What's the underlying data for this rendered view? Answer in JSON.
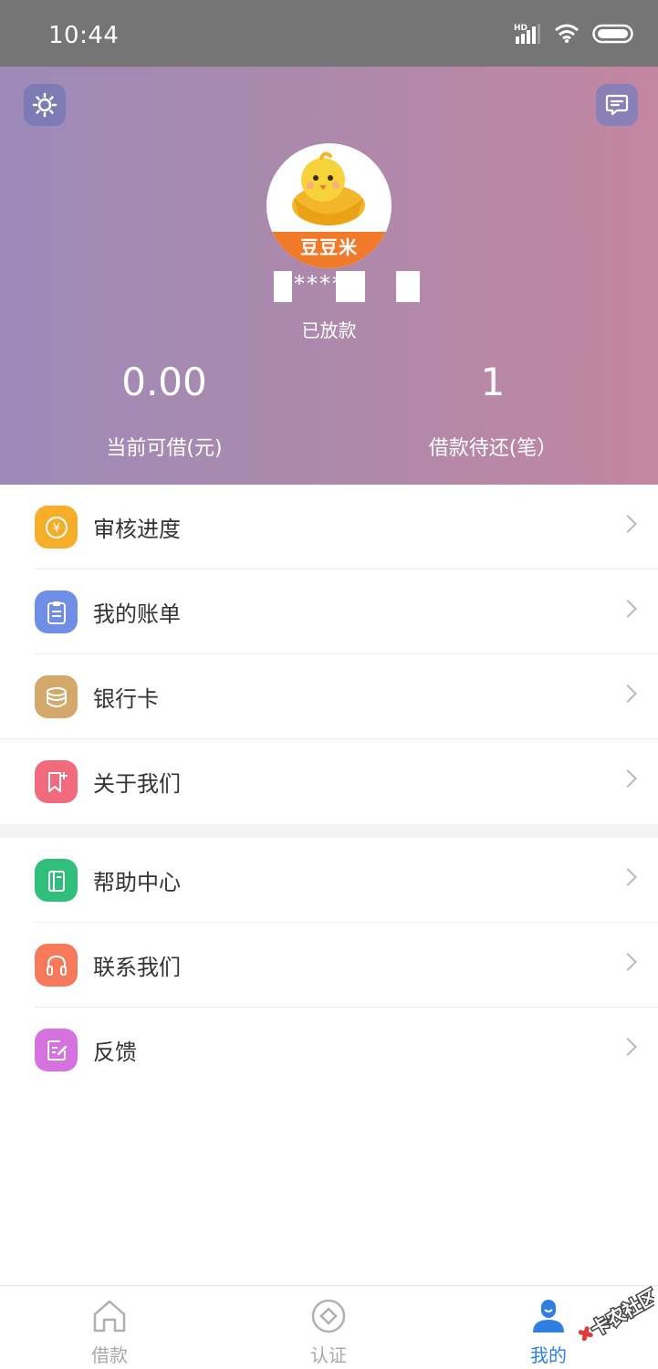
{
  "status_bar": {
    "time": "10:44",
    "network_badge": "HD"
  },
  "header": {
    "settings_icon": "gear-icon",
    "message_icon": "chat-bubble-icon",
    "avatar_text": "豆豆米",
    "username_visible": "****",
    "loan_status": "已放款",
    "stats": [
      {
        "value": "0.00",
        "label": "当前可借(元)"
      },
      {
        "value": "1",
        "label": "借款待还(笔）"
      }
    ],
    "gradient_colors": [
      "#9d8ab9",
      "#c386a0"
    ]
  },
  "menu": {
    "group1": [
      {
        "label": "审核进度",
        "icon": "yen-coin-icon",
        "color": "#f6ae2a"
      },
      {
        "label": "我的账单",
        "icon": "clipboard-icon",
        "color": "#6f8fe6"
      },
      {
        "label": "银行卡",
        "icon": "coin-stack-icon",
        "color": "#d4a86a"
      },
      {
        "label": "关于我们",
        "icon": "bookmark-plus-icon",
        "color": "#f26b7d"
      }
    ],
    "group2": [
      {
        "label": "帮助中心",
        "icon": "book-icon",
        "color": "#2fbf7b"
      },
      {
        "label": "联系我们",
        "icon": "headset-icon",
        "color": "#f5795a"
      },
      {
        "label": "反馈",
        "icon": "edit-note-icon",
        "color": "#d672e0"
      }
    ]
  },
  "tabbar": {
    "tabs": [
      {
        "label": "借款",
        "icon": "home-icon"
      },
      {
        "label": "认证",
        "icon": "diamond-circle-icon"
      },
      {
        "label": "我的",
        "icon": "user-icon",
        "active": true
      }
    ],
    "active_color": "#2f7fe0",
    "watermark_text": "卡农社区"
  }
}
